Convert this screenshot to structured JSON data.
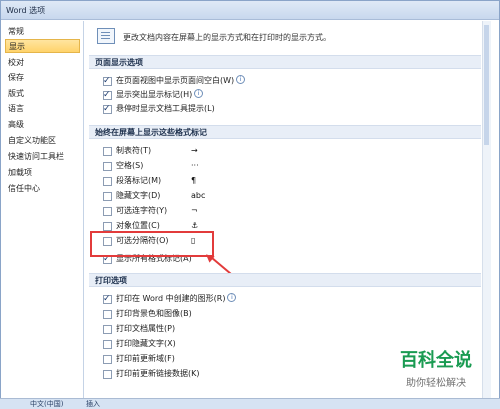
{
  "window": {
    "title": "Word 选项"
  },
  "sidebar": {
    "items": [
      {
        "label": "常规",
        "active": false
      },
      {
        "label": "显示",
        "active": true
      },
      {
        "label": "校对",
        "active": false
      },
      {
        "label": "保存",
        "active": false
      },
      {
        "label": "版式",
        "active": false
      },
      {
        "label": "语言",
        "active": false
      },
      {
        "label": "高级",
        "active": false
      },
      {
        "label": "自定义功能区",
        "active": false
      },
      {
        "label": "快速访问工具栏",
        "active": false
      },
      {
        "label": "加载项",
        "active": false
      },
      {
        "label": "信任中心",
        "active": false
      }
    ]
  },
  "header": {
    "text": "更改文档内容在屏幕上的显示方式和在打印时的显示方式。"
  },
  "sections": {
    "page_display": {
      "title": "页面显示选项",
      "options": [
        {
          "label": "在页面视图中显示页面间空白(W)",
          "checked": true,
          "info": true
        },
        {
          "label": "显示突出显示标记(H)",
          "checked": true,
          "info": true
        },
        {
          "label": "悬停时显示文档工具提示(L)",
          "checked": true,
          "info": false
        }
      ]
    },
    "format_marks": {
      "title": "始终在屏幕上显示这些格式标记",
      "options": [
        {
          "label": "制表符(T)",
          "checked": false,
          "symbol": "→"
        },
        {
          "label": "空格(S)",
          "checked": false,
          "symbol": "···"
        },
        {
          "label": "段落标记(M)",
          "checked": false,
          "symbol": "¶"
        },
        {
          "label": "隐藏文字(D)",
          "checked": false,
          "symbol": "abc"
        },
        {
          "label": "可选连字符(Y)",
          "checked": false,
          "symbol": "¬"
        },
        {
          "label": "对象位置(C)",
          "checked": false,
          "symbol": "⚓"
        },
        {
          "label": "可选分隔符(O)",
          "checked": false,
          "symbol": "▯"
        },
        {
          "label": "显示所有格式标记(A)",
          "checked": true,
          "symbol": ""
        }
      ]
    },
    "print": {
      "title": "打印选项",
      "options": [
        {
          "label": "打印在 Word 中创建的图形(R)",
          "checked": true,
          "info": true
        },
        {
          "label": "打印背景色和图像(B)",
          "checked": false,
          "info": false
        },
        {
          "label": "打印文档属性(P)",
          "checked": false,
          "info": false
        },
        {
          "label": "打印隐藏文字(X)",
          "checked": false,
          "info": false
        },
        {
          "label": "打印前更新域(F)",
          "checked": false,
          "info": false
        },
        {
          "label": "打印前更新链接数据(K)",
          "checked": false,
          "info": false
        }
      ]
    }
  },
  "watermark": {
    "title": "百科全说",
    "subtitle": "助你轻松解决"
  },
  "statusbar": {
    "lang": "中文(中国)",
    "mode": "插入"
  },
  "colors": {
    "highlight": "#e23b3b",
    "active_nav": "#ffd36b",
    "brand": "#1a9b52"
  }
}
